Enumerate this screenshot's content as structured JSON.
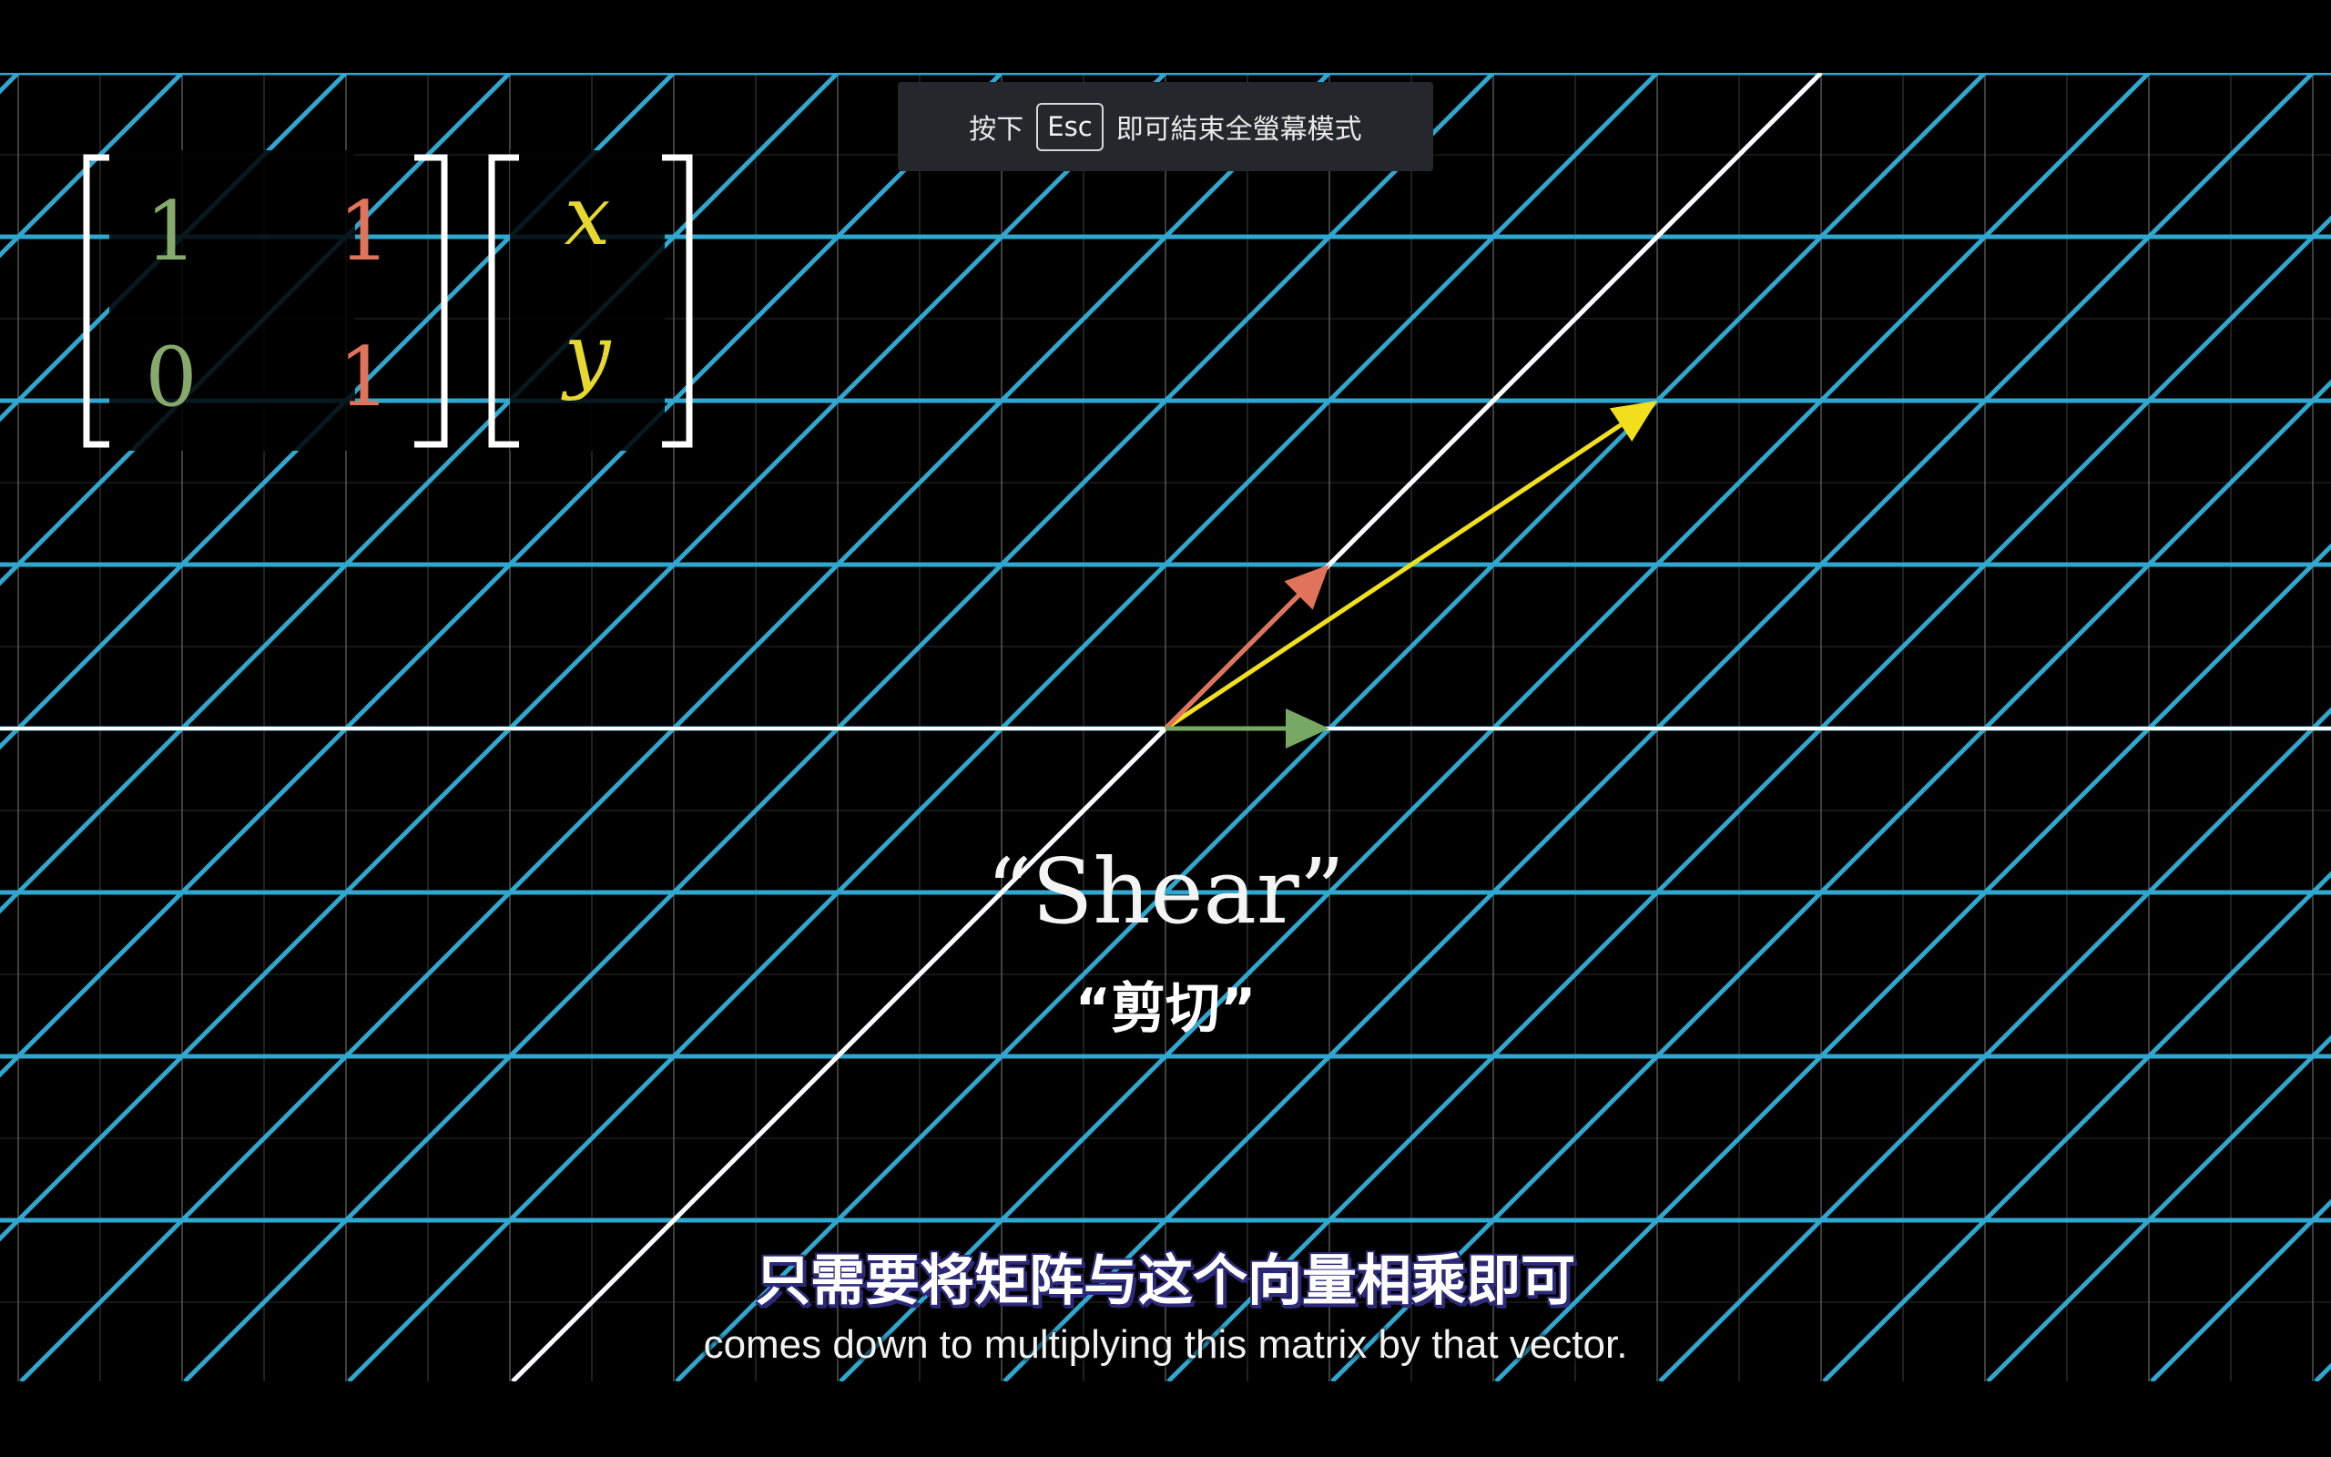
{
  "fullscreen_hint": {
    "prefix": "按下",
    "key": "Esc",
    "suffix": "即可結束全螢幕模式"
  },
  "matrix": {
    "entries": [
      [
        "1",
        "1"
      ],
      [
        "0",
        "1"
      ]
    ],
    "vector": [
      "x",
      "y"
    ],
    "colors": {
      "col1": "#87a96b",
      "col2": "#e0735a",
      "vector": "#e6d82e"
    }
  },
  "title": {
    "en": "“Shear”",
    "cn": "“剪切”"
  },
  "subtitles": {
    "cn": "只需要将矩阵与这个向量相乘即可",
    "en": "comes down to multiplying this matrix by that vector."
  },
  "vectors": {
    "i_hat": {
      "x": 1,
      "y": 0,
      "color": "#77a864"
    },
    "j_hat": {
      "x": 1,
      "y": 1,
      "color": "#e0735a"
    },
    "v": {
      "x": 3,
      "y": 2,
      "color": "#f2e01c"
    }
  },
  "grid": {
    "line_color": "#2fa7cf",
    "background_grid_color": "#5a5a5a",
    "span_line_color": "#ffffff"
  }
}
